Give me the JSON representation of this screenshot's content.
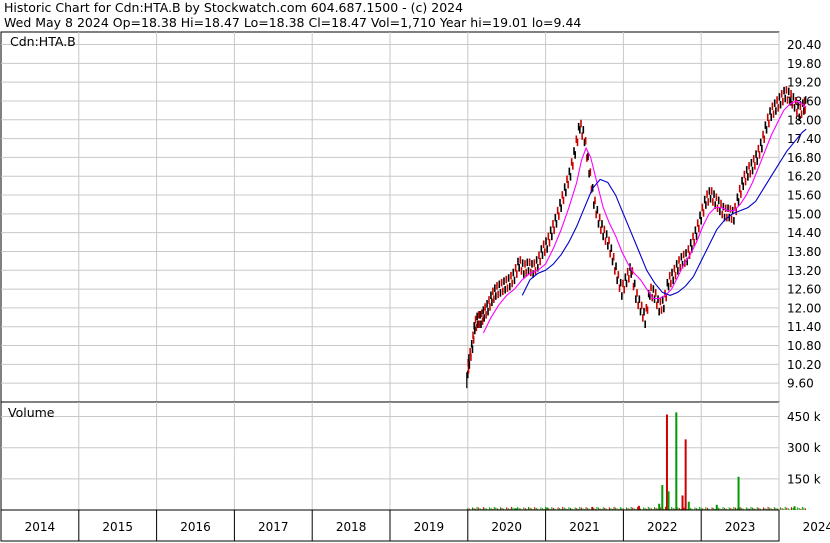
{
  "header": {
    "title_line": "Historic Chart for Cdn:HTA.B by Stockwatch.com 604.687.1500 - (c) 2024",
    "info_line": "Wed May  8 2024   Op=18.38   Hi=18.47   Lo=18.38   Cl=18.47   Vol=1,710   Year hi=19.01   lo=9.44"
  },
  "chart_data": [
    {
      "type": "line",
      "title": "Cdn:HTA.B",
      "price_ticks": [
        "20.40",
        "19.80",
        "19.20",
        "18.60",
        "18.00",
        "17.40",
        "16.80",
        "16.20",
        "15.60",
        "15.00",
        "14.40",
        "13.80",
        "13.20",
        "12.60",
        "12.00",
        "11.40",
        "10.80",
        "10.20",
        "9.60"
      ],
      "ylim": [
        9.0,
        20.8
      ],
      "x_axis_years": [
        "2014",
        "2015",
        "2016",
        "2017",
        "2018",
        "2019",
        "2020",
        "2021",
        "2022",
        "2023",
        "2024"
      ],
      "series": [
        {
          "name": "",
          "style": "price",
          "color": "#cc0000",
          "x": [
            2020.0,
            2020.02,
            2020.06,
            2020.09,
            2020.13,
            2020.17,
            2020.21,
            2020.26,
            2020.31,
            2020.36,
            2020.42,
            2020.48,
            2020.54,
            2020.6,
            2020.66,
            2020.72,
            2020.78,
            2020.84,
            2020.9,
            2020.96,
            2021.02,
            2021.08,
            2021.14,
            2021.2,
            2021.26,
            2021.32,
            2021.38,
            2021.44,
            2021.5,
            2021.56,
            2021.62,
            2021.68,
            2021.74,
            2021.8,
            2021.86,
            2021.92,
            2021.98,
            2022.04,
            2022.1,
            2022.16,
            2022.22,
            2022.28,
            2022.34,
            2022.4,
            2022.46,
            2022.52,
            2022.58,
            2022.64,
            2022.7,
            2022.76,
            2022.82,
            2022.88,
            2022.94,
            2023.0,
            2023.06,
            2023.12,
            2023.18,
            2023.24,
            2023.3,
            2023.36,
            2023.42,
            2023.48,
            2023.54,
            2023.6,
            2023.66,
            2023.72,
            2023.78,
            2023.84,
            2023.9,
            2023.96,
            2024.02,
            2024.08,
            2024.14,
            2024.2,
            2024.26,
            2024.32,
            2024.35
          ],
          "values": [
            10.0,
            10.3,
            10.8,
            11.4,
            11.6,
            11.6,
            11.8,
            12.0,
            12.3,
            12.5,
            12.6,
            12.7,
            12.8,
            13.0,
            13.4,
            13.2,
            13.3,
            13.2,
            13.4,
            13.8,
            14.0,
            14.4,
            14.8,
            15.3,
            15.8,
            16.3,
            17.0,
            17.8,
            17.4,
            16.4,
            15.4,
            14.8,
            14.4,
            14.1,
            13.6,
            13.0,
            12.5,
            12.9,
            13.2,
            12.4,
            12.0,
            11.6,
            12.5,
            12.4,
            12.0,
            12.1,
            12.8,
            13.0,
            13.3,
            13.5,
            13.6,
            14.0,
            14.4,
            14.9,
            15.4,
            15.6,
            15.4,
            15.2,
            15.0,
            15.0,
            14.9,
            15.5,
            16.0,
            16.3,
            16.5,
            16.8,
            17.2,
            17.8,
            18.2,
            18.4,
            18.6,
            18.8,
            18.7,
            18.5,
            18.2,
            18.4,
            18.47
          ]
        },
        {
          "name": "",
          "style": "moving-average-short",
          "color": "#ff00ff",
          "x": [
            2020.2,
            2020.3,
            2020.4,
            2020.5,
            2020.6,
            2020.7,
            2020.8,
            2020.9,
            2021.0,
            2021.1,
            2021.2,
            2021.3,
            2021.4,
            2021.46,
            2021.52,
            2021.58,
            2021.66,
            2021.74,
            2021.82,
            2021.9,
            2021.98,
            2022.06,
            2022.14,
            2022.22,
            2022.3,
            2022.38,
            2022.46,
            2022.54,
            2022.62,
            2022.7,
            2022.78,
            2022.86,
            2022.94,
            2023.02,
            2023.1,
            2023.18,
            2023.26,
            2023.34,
            2023.42,
            2023.5,
            2023.58,
            2023.66,
            2023.74,
            2023.82,
            2023.9,
            2023.98,
            2024.06,
            2024.14,
            2024.22,
            2024.3,
            2024.35
          ],
          "values": [
            11.2,
            11.7,
            12.1,
            12.4,
            12.6,
            12.9,
            13.1,
            13.2,
            13.4,
            13.9,
            14.5,
            15.2,
            16.0,
            16.7,
            17.1,
            16.8,
            16.0,
            15.2,
            14.7,
            14.3,
            13.8,
            13.4,
            13.1,
            12.9,
            12.6,
            12.3,
            12.3,
            12.4,
            12.6,
            13.0,
            13.4,
            13.7,
            14.1,
            14.6,
            15.0,
            15.2,
            15.2,
            15.1,
            15.1,
            15.3,
            15.6,
            16.0,
            16.5,
            17.0,
            17.5,
            17.9,
            18.3,
            18.5,
            18.6,
            18.5,
            18.4
          ]
        },
        {
          "name": "",
          "style": "moving-average-long",
          "color": "#0000cc",
          "x": [
            2020.7,
            2020.8,
            2020.9,
            2021.0,
            2021.1,
            2021.2,
            2021.3,
            2021.4,
            2021.5,
            2021.6,
            2021.7,
            2021.8,
            2021.9,
            2022.0,
            2022.1,
            2022.2,
            2022.3,
            2022.4,
            2022.5,
            2022.6,
            2022.7,
            2022.8,
            2022.9,
            2023.0,
            2023.1,
            2023.2,
            2023.3,
            2023.4,
            2023.5,
            2023.6,
            2023.7,
            2023.8,
            2023.9,
            2024.0,
            2024.1,
            2024.2,
            2024.3,
            2024.35
          ],
          "values": [
            12.4,
            12.9,
            13.1,
            13.2,
            13.4,
            13.7,
            14.1,
            14.6,
            15.2,
            15.8,
            16.1,
            16.0,
            15.6,
            15.0,
            14.4,
            13.8,
            13.2,
            12.8,
            12.5,
            12.4,
            12.5,
            12.7,
            13.0,
            13.5,
            14.0,
            14.5,
            14.8,
            15.0,
            15.1,
            15.2,
            15.4,
            15.8,
            16.2,
            16.6,
            17.0,
            17.3,
            17.6,
            17.7
          ]
        }
      ]
    },
    {
      "type": "bar",
      "title": "Volume",
      "volume_ticks": [
        "450 k",
        "300 k",
        "150 k"
      ],
      "ylim": [
        0,
        520000
      ],
      "x": [
        2022.46,
        2022.5,
        2022.56,
        2022.58,
        2022.68,
        2022.76,
        2022.8,
        2022.84,
        2023.48,
        2021.02,
        2020.62,
        2021.6,
        2022.2,
        2023.2,
        2024.2
      ],
      "values": [
        30000,
        120000,
        460000,
        90000,
        470000,
        70000,
        340000,
        40000,
        160000,
        12000,
        8000,
        15000,
        20000,
        25000,
        18000
      ],
      "colors": [
        "#009900",
        "#009900",
        "#cc0000",
        "#009900",
        "#009900",
        "#cc0000",
        "#cc0000",
        "#009900",
        "#009900",
        "#009900",
        "#009900",
        "#cc0000",
        "#cc0000",
        "#009900",
        "#009900"
      ]
    }
  ]
}
